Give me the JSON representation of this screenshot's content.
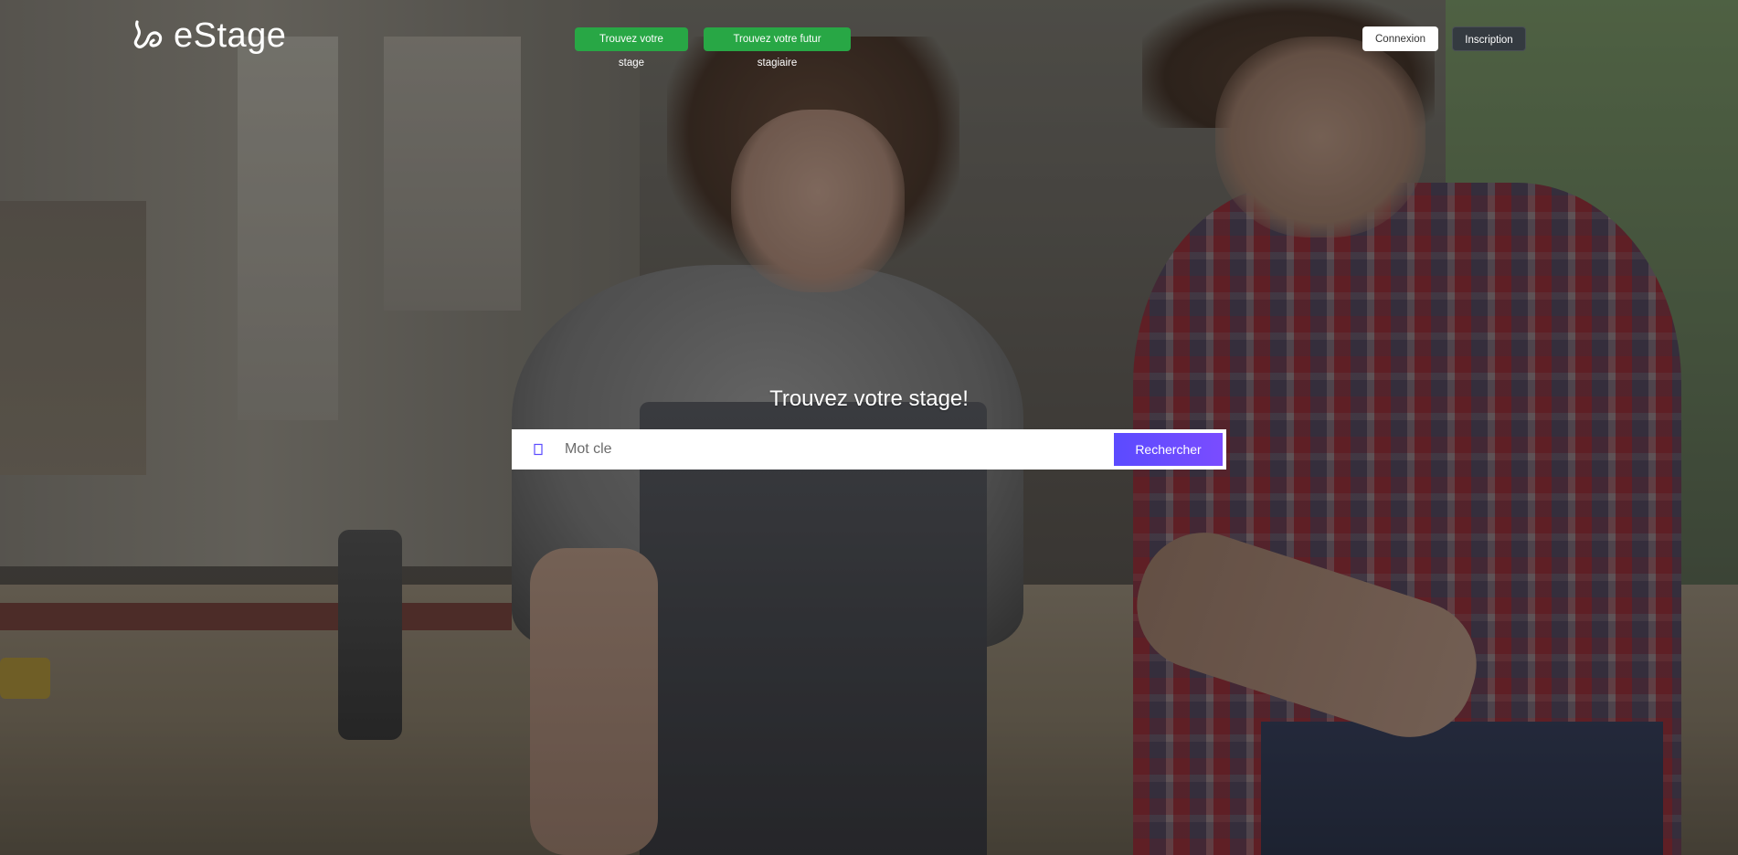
{
  "brand": {
    "name": "eStage",
    "logo_icon": "estage-logo-icon"
  },
  "nav": {
    "find_internship_label": "Trouvez votre stage",
    "find_intern_label": "Trouvez votre futur stagiaire",
    "button_color": "#28a745"
  },
  "auth": {
    "login_label": "Connexion",
    "signup_label": "Inscription"
  },
  "hero": {
    "headline": "Trouvez votre stage!",
    "background_image": "workshop-photo"
  },
  "search": {
    "icon": "search-icon",
    "placeholder": "Mot cle",
    "value": "",
    "button_label": "Rechercher",
    "button_color": "#5b4bff"
  }
}
